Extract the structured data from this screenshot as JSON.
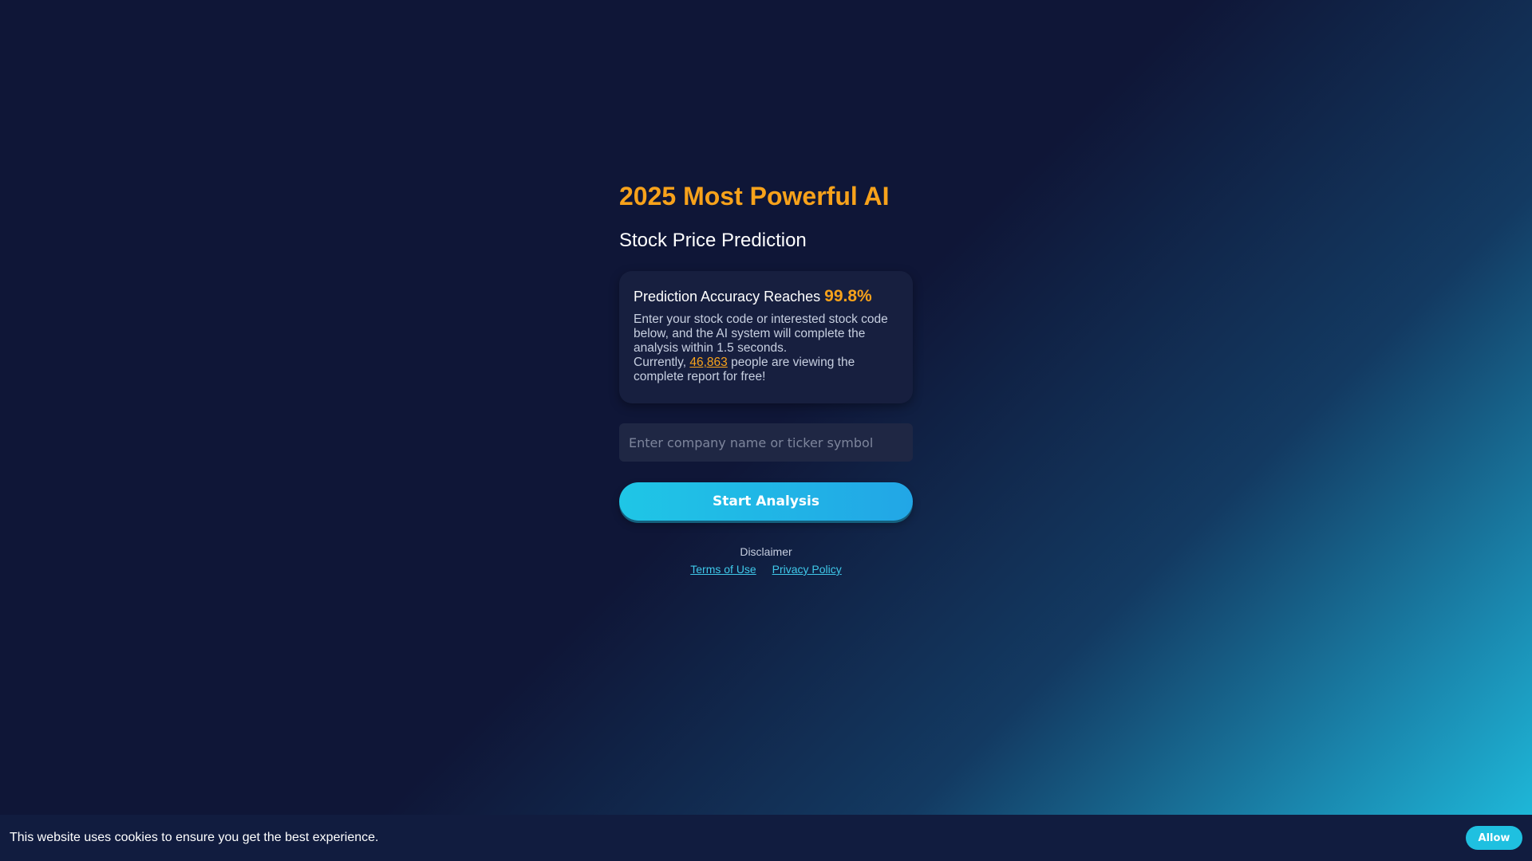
{
  "hero": {
    "title": "2025 Most Powerful AI",
    "subtitle": "Stock Price Prediction"
  },
  "card": {
    "accuracy_label": "Prediction Accuracy Reaches",
    "accuracy_value": "99.8%",
    "description": "Enter your stock code or interested stock code below, and the AI system will complete the analysis within 1.5 seconds.",
    "viewers_prefix": "Currently,",
    "viewers_count": "46,863",
    "viewers_suffix": "people are viewing the complete report for free!"
  },
  "search": {
    "placeholder": "Enter company name or ticker symbol",
    "value": ""
  },
  "cta": {
    "label": "Start Analysis"
  },
  "footer": {
    "disclaimer": "Disclaimer",
    "terms_label": "Terms of Use",
    "privacy_label": "Privacy Policy"
  },
  "cookie": {
    "message": "This website uses cookies to ensure you get the best experience.",
    "allow_label": "Allow"
  },
  "colors": {
    "accent": "#f7a21b",
    "button": "#1fc0e0",
    "background": "#0f1637",
    "link": "#3fc9ea"
  }
}
